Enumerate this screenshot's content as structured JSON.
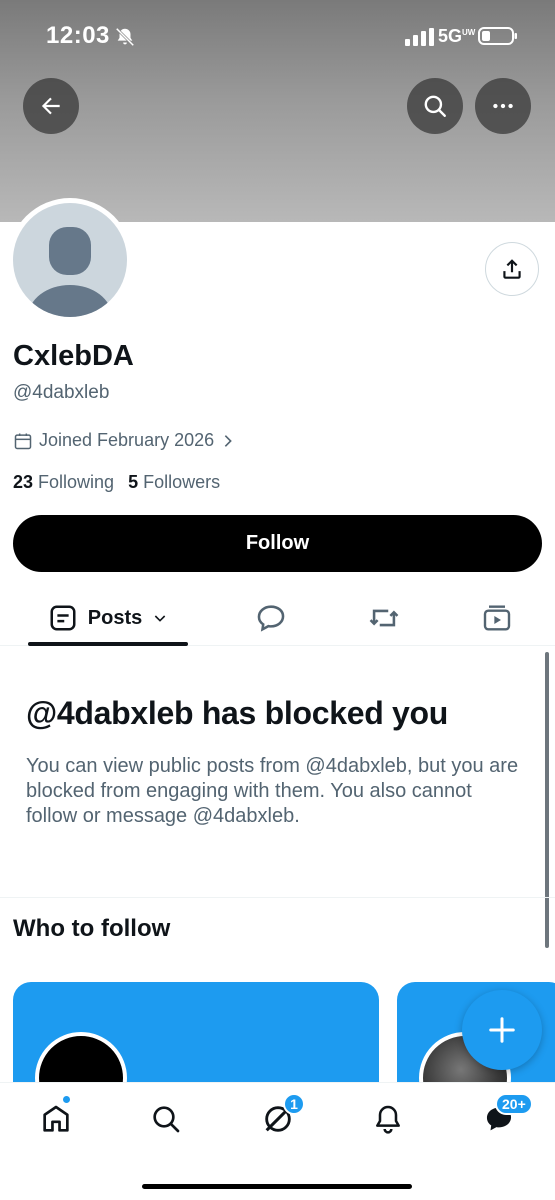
{
  "status_bar": {
    "time": "12:03",
    "network": "5G",
    "network_super": "UW"
  },
  "profile": {
    "display_name": "CxlebDA",
    "handle": "@4dabxleb",
    "joined": "Joined February 2026",
    "following_count": "23",
    "following_label": "Following",
    "followers_count": "5",
    "followers_label": "Followers",
    "follow_button": "Follow"
  },
  "tabs": [
    {
      "label": "Posts",
      "icon": "posts-icon",
      "active": true
    },
    {
      "label": "",
      "icon": "replies-icon"
    },
    {
      "label": "",
      "icon": "reposts-icon"
    },
    {
      "label": "",
      "icon": "media-icon"
    }
  ],
  "blocked": {
    "title": "@4dabxleb has blocked you",
    "body": "You can view public posts from @4dabxleb, but you are blocked from engaging with them. You also cannot follow or message @4dabxleb."
  },
  "who_to_follow": {
    "title": "Who to follow"
  },
  "bottom_nav": {
    "items": [
      "home-icon",
      "search-icon",
      "grok-icon",
      "bell-icon",
      "messages-icon"
    ],
    "grok_badge": "1",
    "messages_badge": "20+"
  },
  "colors": {
    "accent": "#1d9bf0",
    "text": "#0f1419",
    "secondary_text": "#536471",
    "button": "#000000"
  }
}
